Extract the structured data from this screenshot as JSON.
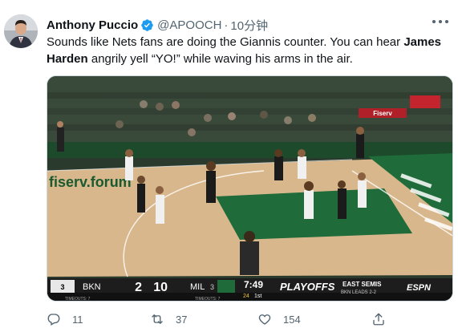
{
  "tweet": {
    "author_name": "Anthony Puccio",
    "handle": "@APOOCH",
    "separator": "·",
    "time": "10分钟",
    "text_part1": "Sounds like Nets fans are doing the Giannis counter. You can hear ",
    "text_bold": "James Harden",
    "text_part2": " angrily yell “YO!” while waving his arms in the air."
  },
  "media": {
    "scoreboard": {
      "team1": "BKN",
      "team1_seed": "3",
      "score1": "2",
      "score2": "10",
      "team2": "MIL",
      "team2_seed": "3",
      "game_clock": "7:49",
      "shot_clock": "24",
      "quarter": "1st",
      "network": "ESPN",
      "playoffs_label": "PLAYOFFS",
      "series_label": "EAST SEMIS",
      "series_status": "BKN LEADS 2-2",
      "timeouts1": "TIMEOUTS: 7",
      "timeouts2": "TIMEOUTS: 7"
    },
    "court_banner": "fiserv.forum",
    "sponsor_sign": "Fiserv"
  },
  "actions": {
    "replies": "11",
    "retweets": "37",
    "likes": "154"
  },
  "colors": {
    "verified": "#1d9bf0",
    "secondary_text": "#536471",
    "court_green": "#1f6b3a",
    "court_wood": "#d8b48a"
  }
}
